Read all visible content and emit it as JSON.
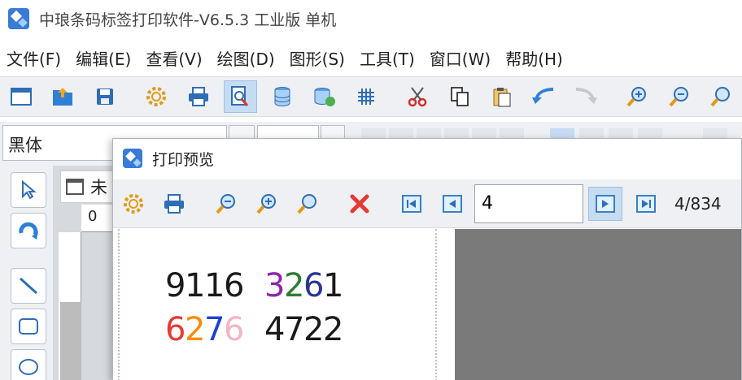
{
  "app": {
    "title": "中琅条码标签打印软件-V6.5.3 工业版 单机"
  },
  "menu": [
    {
      "label": "文件(F)"
    },
    {
      "label": "编辑(E)"
    },
    {
      "label": "查看(V)"
    },
    {
      "label": "绘图(D)"
    },
    {
      "label": "图形(S)"
    },
    {
      "label": "工具(T)"
    },
    {
      "label": "窗口(W)"
    },
    {
      "label": "帮助(H)"
    }
  ],
  "toolbar_icons": [
    "window-icon",
    "open-icon",
    "save-icon",
    "settings-icon",
    "print-icon",
    "print-preview-icon",
    "database-icon",
    "database-connect-icon",
    "grid-icon",
    "cut-icon",
    "copy-icon",
    "paste-icon",
    "undo-icon",
    "redo-icon",
    "zoom-in-icon",
    "zoom-out-icon",
    "zoom-fit-icon"
  ],
  "font": {
    "family_value": "黑体"
  },
  "document": {
    "tab_label": "未",
    "ruler_label": "0"
  },
  "dialog": {
    "title": "打印预览",
    "page_input": "4",
    "page_count": "4/834"
  },
  "preview": {
    "rows": [
      {
        "groups": [
          [
            {
              "ch": "9",
              "color": "#1a1a1a"
            },
            {
              "ch": "1",
              "color": "#1a1a1a"
            },
            {
              "ch": "1",
              "color": "#1a1a1a"
            },
            {
              "ch": "6",
              "color": "#1a1a1a"
            }
          ],
          [
            {
              "ch": "3",
              "color": "#8e24aa"
            },
            {
              "ch": "2",
              "color": "#2e7d32"
            },
            {
              "ch": "6",
              "color": "#283593"
            },
            {
              "ch": "1",
              "color": "#1a1a1a"
            }
          ]
        ]
      },
      {
        "groups": [
          [
            {
              "ch": "6",
              "color": "#e53935"
            },
            {
              "ch": "2",
              "color": "#fb8c00"
            },
            {
              "ch": "7",
              "color": "#1e40d0"
            },
            {
              "ch": "6",
              "color": "#f4b5c4"
            }
          ],
          [
            {
              "ch": "4",
              "color": "#1a1a1a"
            },
            {
              "ch": "7",
              "color": "#1a1a1a"
            },
            {
              "ch": "2",
              "color": "#1a1a1a"
            },
            {
              "ch": "2",
              "color": "#1a1a1a"
            }
          ]
        ]
      }
    ]
  },
  "colors": {
    "accent": "#3a7bd5",
    "toolbar_bg": "#eef0f3",
    "active_btn": "#c6dcf3",
    "preview_gray": "#7a7a7a"
  }
}
